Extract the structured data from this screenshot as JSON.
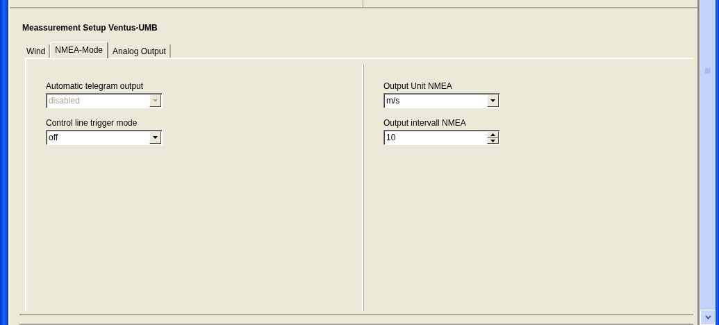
{
  "title": "Meassurement Setup Ventus-UMB",
  "tabs": [
    {
      "label": "Wind",
      "selected": false
    },
    {
      "label": "NMEA-Mode",
      "selected": true
    },
    {
      "label": "Analog Output",
      "selected": false
    }
  ],
  "left_fields": [
    {
      "kind": "combo",
      "label": "Automatic telegram output",
      "value": "disabled",
      "disabled": true
    },
    {
      "kind": "combo",
      "label": "Control line trigger mode",
      "value": "off",
      "disabled": false
    }
  ],
  "right_fields": [
    {
      "kind": "combo",
      "label": "Output Unit NMEA",
      "value": "m/s",
      "disabled": false
    },
    {
      "kind": "spin",
      "label": "Output intervall NMEA",
      "value": "10",
      "disabled": false
    }
  ]
}
